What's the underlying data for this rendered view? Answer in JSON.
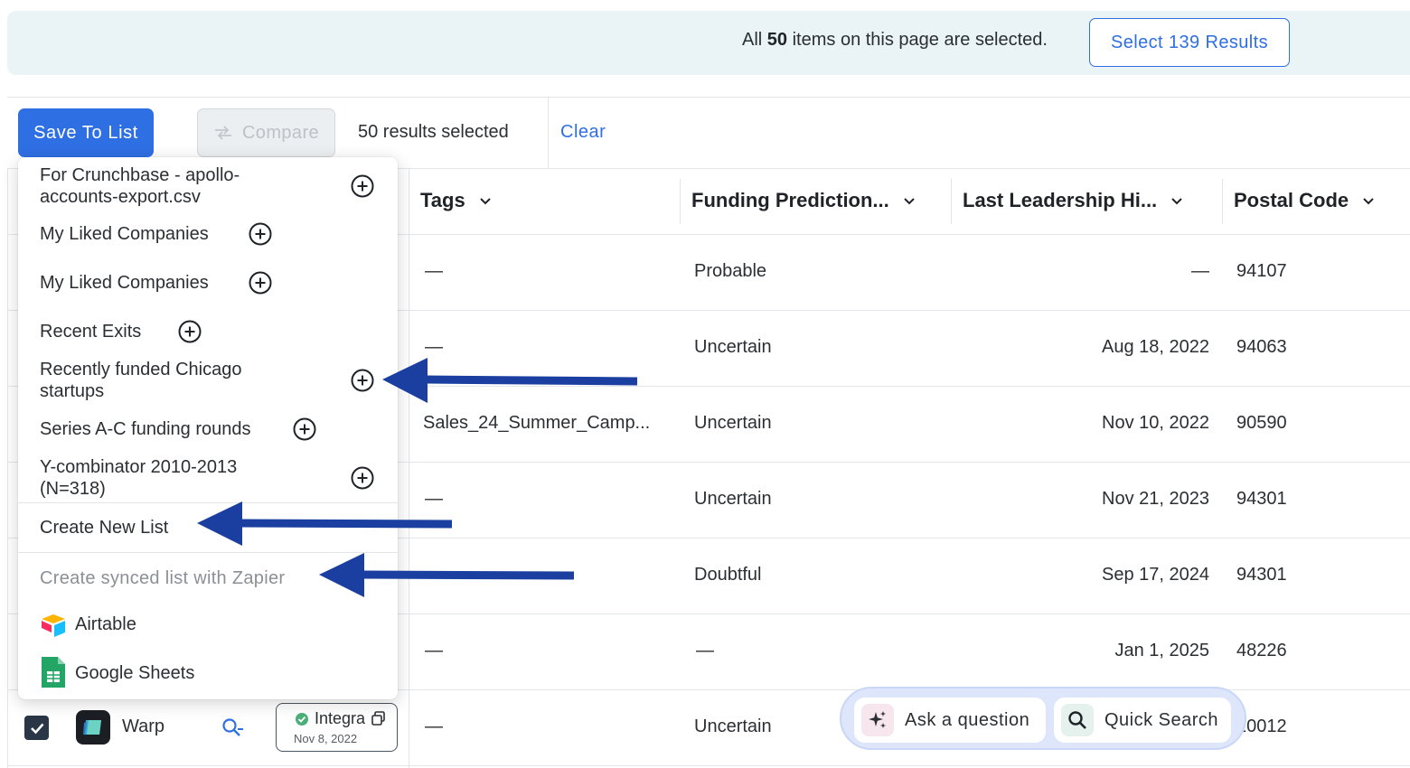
{
  "banner": {
    "text_prefix": "All ",
    "text_count": "50",
    "text_suffix": " items on this page are selected.",
    "select_all_label": "Select 139 Results"
  },
  "toolbar": {
    "save_label": "Save To List",
    "compare_label": "Compare",
    "selected_text": "50 results selected",
    "clear_label": "Clear"
  },
  "columns": [
    {
      "label": "Tags"
    },
    {
      "label": "Funding Prediction..."
    },
    {
      "label": "Last Leadership Hi..."
    },
    {
      "label": "Postal Code"
    }
  ],
  "rows": [
    {
      "tags": "—",
      "funding": "Probable",
      "leadership": "—",
      "postal": "94107"
    },
    {
      "tags": "—",
      "funding": "Uncertain",
      "leadership": "Aug 18, 2022",
      "postal": "94063"
    },
    {
      "tags": "Sales_24_Summer_Camp...",
      "funding": "Uncertain",
      "leadership": "Nov 10, 2022",
      "postal": "90590"
    },
    {
      "tags": "—",
      "funding": "Uncertain",
      "leadership": "Nov 21, 2023",
      "postal": "94301"
    },
    {
      "tags": "",
      "funding": "Doubtful",
      "leadership": "Sep 17, 2024",
      "postal": "94301"
    },
    {
      "tags": "—",
      "funding": "—",
      "leadership": "Jan 1, 2025",
      "postal": "48226"
    },
    {
      "tags": "—",
      "funding": "Uncertain",
      "leadership": "",
      "postal": "10012"
    }
  ],
  "last_row": {
    "company": "Warp",
    "integration_label": "Integra",
    "integration_date": "Nov 8, 2022"
  },
  "menu": {
    "lists": [
      {
        "line1": "For Crunchbase - apollo-",
        "line2": "accounts-export.csv"
      },
      {
        "line1": "My Liked Companies",
        "line2": ""
      },
      {
        "line1": "My Liked Companies",
        "line2": ""
      },
      {
        "line1": "Recent Exits",
        "line2": ""
      },
      {
        "line1": "Recently funded Chicago",
        "line2": "startups"
      },
      {
        "line1": "Series A-C funding rounds",
        "line2": ""
      },
      {
        "line1": "Y-combinator 2010-2013",
        "line2": "(N=318)"
      }
    ],
    "create_new": "Create New List",
    "synced_header": "Create synced list with Zapier",
    "airtable": "Airtable",
    "google_sheets": "Google Sheets"
  },
  "assistant": {
    "ask_label": "Ask a question",
    "search_label": "Quick Search"
  },
  "colors": {
    "accent": "#2f6fe4",
    "arrow": "#1b3fa0",
    "banner_bg": "#eaf3f6"
  }
}
